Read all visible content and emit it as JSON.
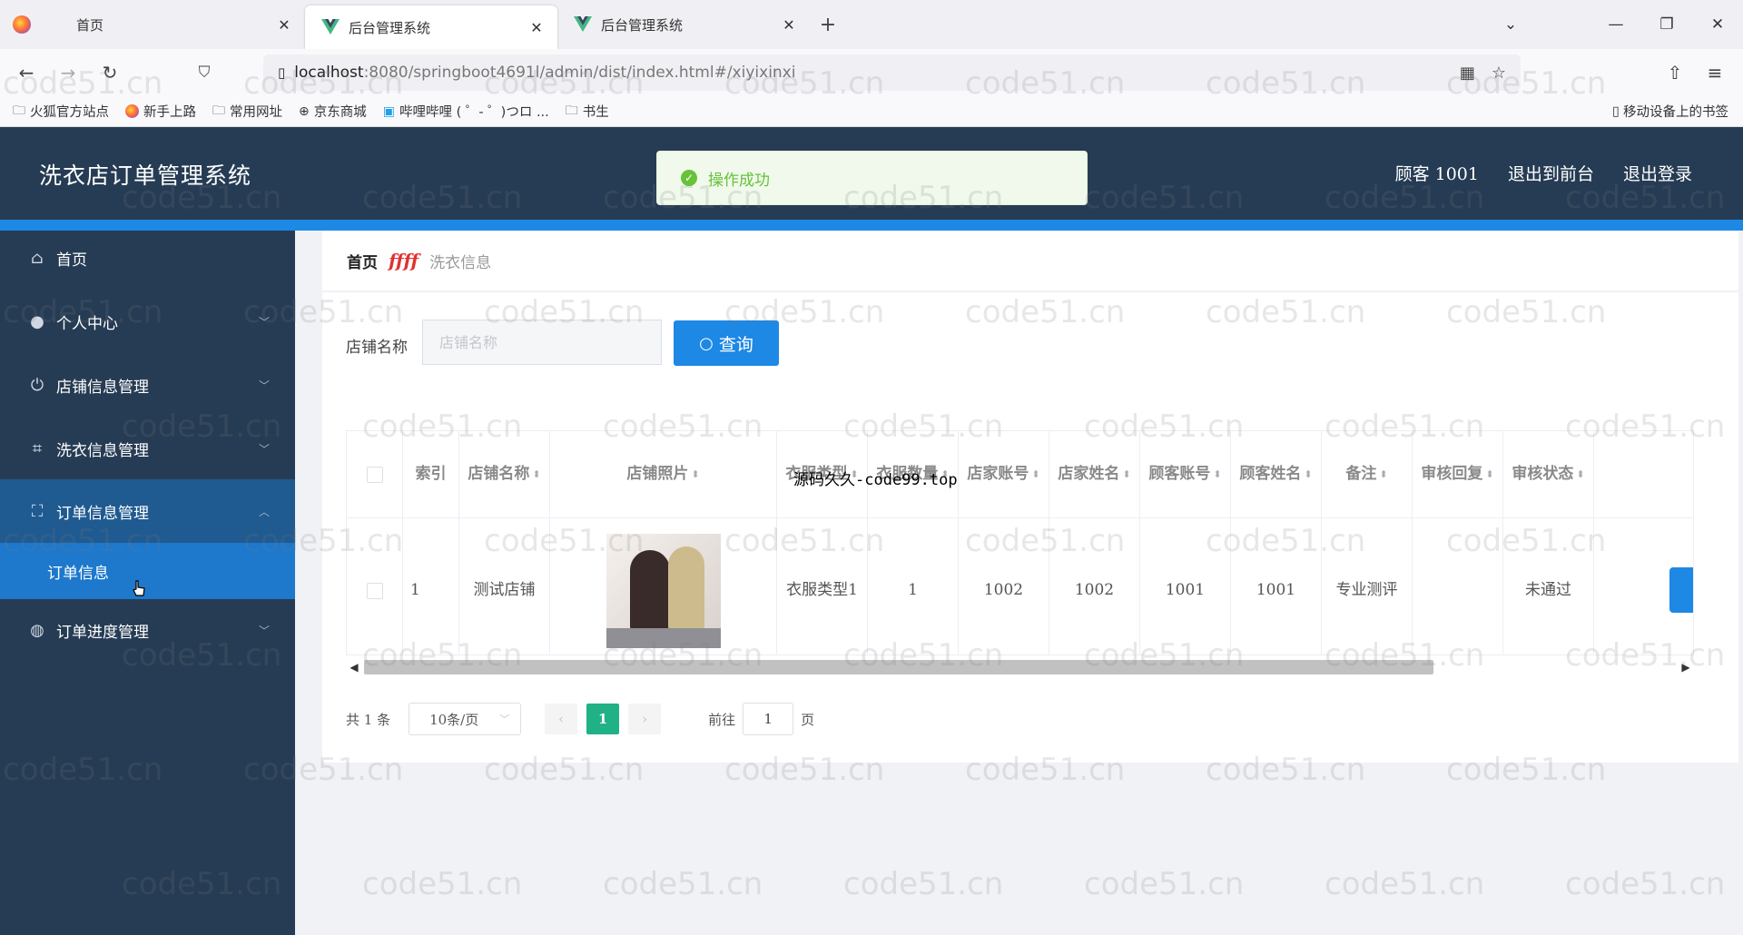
{
  "browser": {
    "tabs": [
      {
        "label": "首页",
        "icon": "firefox-icon",
        "active": false
      },
      {
        "label": "后台管理系统",
        "icon": "vue-icon",
        "active": true
      },
      {
        "label": "后台管理系统",
        "icon": "vue-icon",
        "active": false
      }
    ],
    "url_host": "localhost",
    "url_rest": ":8080/springboot4691l/admin/dist/index.html#/xiyixinxi",
    "bookmarks": [
      {
        "label": "火狐官方站点",
        "icon": "firefox-icon"
      },
      {
        "label": "新手上路",
        "icon": "firefox-icon"
      },
      {
        "label": "常用网址",
        "icon": "folder-icon"
      },
      {
        "label": "京东商城",
        "icon": "globe-icon"
      },
      {
        "label": "哔哩哔哩 ( ゜- ゜)つロ ...",
        "icon": "bilibili-icon"
      },
      {
        "label": "书生",
        "icon": "folder-icon"
      }
    ],
    "mobile_bookmarks": "移动设备上的书签"
  },
  "app": {
    "title": "洗衣店订单管理系统",
    "header_links": [
      "顾客 1001",
      "退出到前台",
      "退出登录"
    ],
    "toast": "操作成功",
    "overlay_text": "源码久久-code99.top",
    "watermark": "code51.cn"
  },
  "sidebar": {
    "items": [
      {
        "label": "首页",
        "icon": "home-icon",
        "arrow": false
      },
      {
        "label": "个人中心",
        "icon": "user-icon",
        "arrow": true
      },
      {
        "label": "店铺信息管理",
        "icon": "power-icon",
        "arrow": true
      },
      {
        "label": "洗衣信息管理",
        "icon": "crop-icon",
        "arrow": true
      },
      {
        "label": "订单信息管理",
        "icon": "fullscreen-icon",
        "arrow": true,
        "open": true
      },
      {
        "label": "订单信息",
        "sub": true
      },
      {
        "label": "订单进度管理",
        "icon": "basketball-icon",
        "arrow": true
      }
    ]
  },
  "breadcrumb": {
    "home": "首页",
    "separator": "ffff",
    "current": "洗衣信息"
  },
  "search": {
    "label": "店铺名称",
    "placeholder": "店铺名称",
    "value": "",
    "button": "查询"
  },
  "table": {
    "headers": [
      "索引",
      "店铺名称",
      "店铺照片",
      "衣服类型",
      "衣服数量",
      "店家账号",
      "店家姓名",
      "顾客账号",
      "顾客姓名",
      "备注",
      "审核回复",
      "审核状态"
    ],
    "rows": [
      {
        "index": "1",
        "shop_name": "测试店铺",
        "photo": "shop-photo",
        "cloth_type": "衣服类型1",
        "cloth_qty": "1",
        "shop_account": "1002",
        "shop_owner": "1002",
        "customer_account": "1001",
        "customer_name": "1001",
        "remark": "专业测评",
        "reply": "",
        "status": "未通过"
      }
    ]
  },
  "pagination": {
    "total": "共 1 条",
    "page_size": "10条/页",
    "current_page": "1",
    "goto_label": "前往",
    "goto_value": "1",
    "page_unit": "页"
  },
  "colors": {
    "header_bg": "#263c54",
    "accent": "#1e88e5",
    "active_page": "#20b286",
    "toast_text": "#67c23a"
  }
}
